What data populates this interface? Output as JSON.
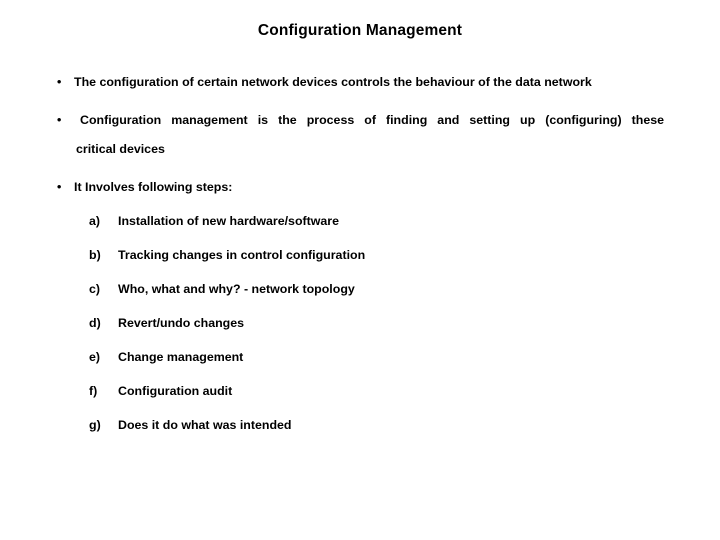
{
  "slide": {
    "title": "Configuration Management",
    "background_color": "#ffffff",
    "text_color": "#000000",
    "bullet_glyph": "•",
    "bullets": [
      {
        "marker": "•",
        "text": "The configuration of certain network devices controls the behaviour of the data network"
      },
      {
        "marker": "•",
        "line1": "Configuration management is the process of finding and setting up (configuring) these",
        "line2": "critical devices"
      },
      {
        "marker": "•",
        "text": "It Involves following steps:"
      }
    ],
    "steps": [
      {
        "marker": "a)",
        "text": "Installation of new hardware/software"
      },
      {
        "marker": "b)",
        "text": "Tracking changes in control configuration"
      },
      {
        "marker": "c)",
        "text": "Who, what and why? - network topology"
      },
      {
        "marker": "d)",
        "text": "Revert/undo changes"
      },
      {
        "marker": "e)",
        "text": "Change management"
      },
      {
        "marker": "f)",
        "text": "Configuration audit"
      },
      {
        "marker": "g)",
        "text": "Does it do what was intended"
      }
    ]
  }
}
